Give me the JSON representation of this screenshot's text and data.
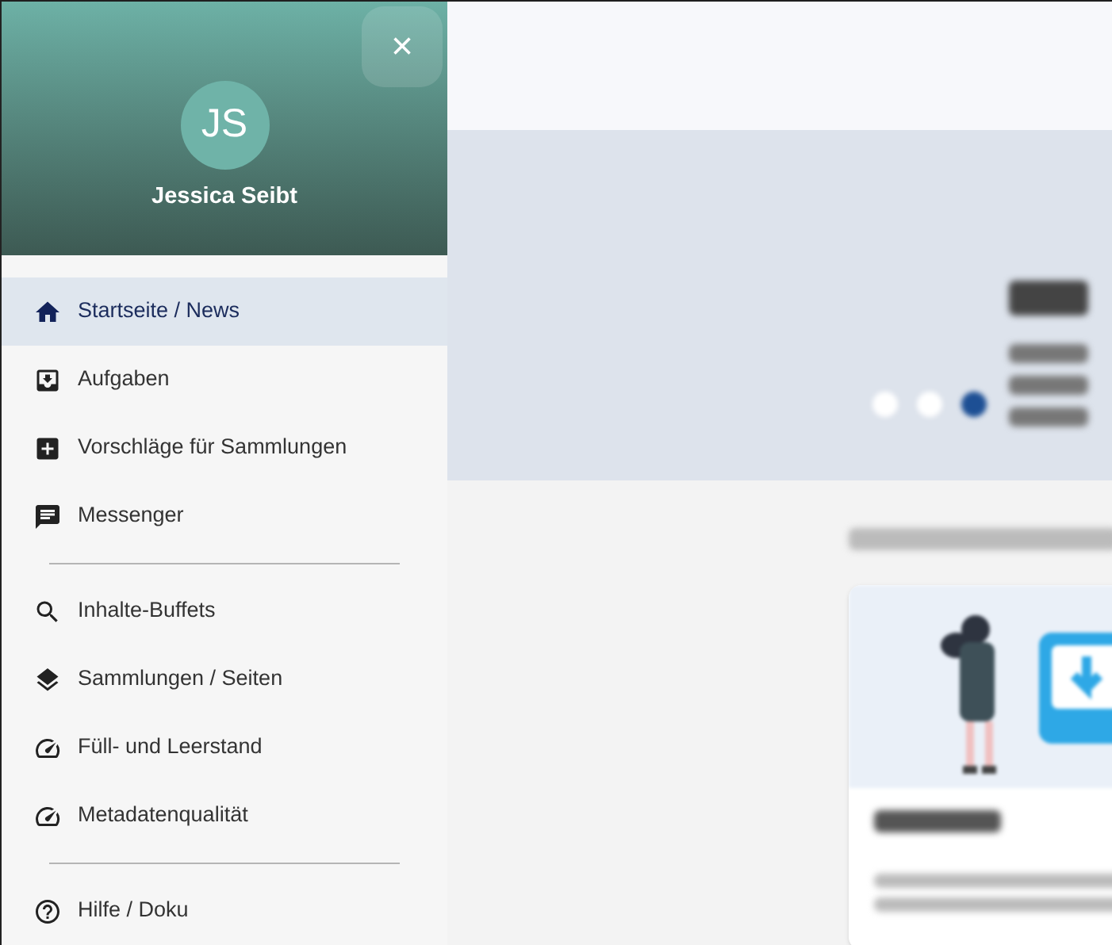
{
  "drawer": {
    "close_label": "×",
    "avatar_initials": "JS",
    "user_name": "Jessica Seibt",
    "groups": [
      {
        "items": [
          {
            "label": "Startseite / News",
            "selected": true
          },
          {
            "label": "Aufgaben",
            "selected": false
          },
          {
            "label": "Vorschläge für Sammlungen",
            "selected": false
          },
          {
            "label": "Messenger",
            "selected": false
          }
        ]
      },
      {
        "items": [
          {
            "label": "Inhalte-Buffets",
            "selected": false
          },
          {
            "label": "Sammlungen / Seiten",
            "selected": false
          },
          {
            "label": "Füll- und Leerstand",
            "selected": false
          },
          {
            "label": "Metadatenqualität",
            "selected": false
          }
        ]
      },
      {
        "items": [
          {
            "label": "Hilfe / Doku",
            "selected": false
          }
        ]
      }
    ]
  },
  "background": {
    "carousel_dots": [
      {
        "selected": false
      },
      {
        "selected": false
      },
      {
        "selected": true
      }
    ]
  }
}
